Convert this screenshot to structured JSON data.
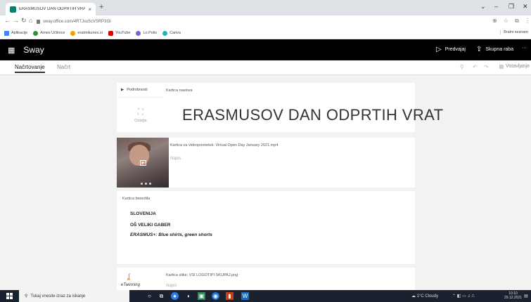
{
  "browser": {
    "tab_title": "ERASMUSOV DAN ODPRTIH VRA",
    "tab_close": "×",
    "new_tab": "+",
    "url": "sway.office.com/4RTJsu5cVSRP3I3i",
    "bookmarks": [
      {
        "label": "Aplikacije",
        "color": "#4285f4"
      },
      {
        "label": "Arnes Učilnice",
        "color": "#2f8f3a"
      },
      {
        "label": "eratmikunes.si",
        "color": "#f0a000"
      },
      {
        "label": "YouTube",
        "color": "#e00000"
      },
      {
        "label": "Lo.Polis",
        "color": "#6a6ad8"
      },
      {
        "label": "Canva",
        "color": "#1fb0c8"
      }
    ],
    "bookmarks_right": "Bralni seznam"
  },
  "sway": {
    "brand": "Sway",
    "preview_label": "Predvajaj",
    "share_label": "Skupna raba",
    "more_label": "···",
    "tabs": [
      {
        "label": "Načrtovanje",
        "active": true
      },
      {
        "label": "Načrt",
        "active": false
      }
    ],
    "design_label": "Vstavljanje"
  },
  "cards": {
    "title_card": {
      "details_label": "Podrobnosti",
      "background_label": "Ozadje",
      "type_label": "Kartica naslova",
      "title": "ERASMUSOV DAN ODPRTIH VRAT"
    },
    "video_card": {
      "type_label": "Kartica za videoposnetek: Virtual Open Day January 2021.mp4",
      "caption_placeholder": "Napis"
    },
    "text_card": {
      "type_label": "Kartica besedila",
      "lines": [
        "SLOVENIJA",
        "OŠ VELIKI GABER",
        "ERASMUS+: Blue shirts, green shorts"
      ]
    },
    "image_card": {
      "type_label": "Kartica slike: VSI LOGOTIPI SKUPAJ.png",
      "logo_text": "eTwinning",
      "caption_placeholder": "Napis"
    }
  },
  "taskbar": {
    "search_placeholder": "Tukaj vnesite izraz za iskanje",
    "weather": "1°C Cloudy",
    "time": "10:10",
    "date": "29.12.2021"
  }
}
